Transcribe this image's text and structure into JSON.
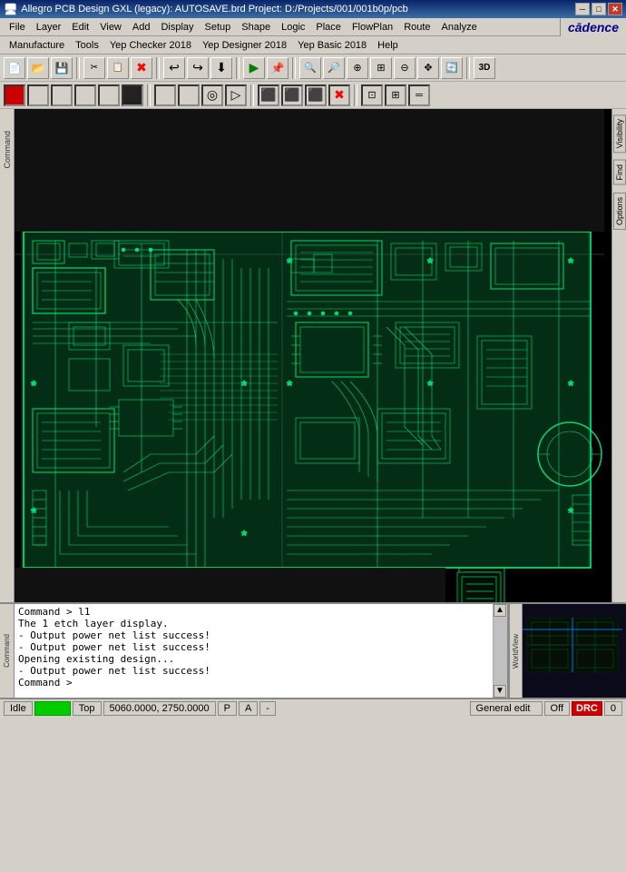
{
  "titlebar": {
    "title": "Allegro PCB Design GXL (legacy): AUTOSAVE.brd  Project: D:/Projects/001/001b0p/pcb",
    "minimize": "─",
    "maximize": "□",
    "close": "✕"
  },
  "menubar1": {
    "items": [
      "File",
      "Layer",
      "Edit",
      "View",
      "Add",
      "Display",
      "Setup",
      "Shape",
      "Logic",
      "Place",
      "FlowPlan",
      "Route",
      "Analyze"
    ]
  },
  "menubar2": {
    "items": [
      "Manufacture",
      "Tools",
      "Yep Checker 2018",
      "Yep Designer 2018",
      "Yep Basic 2018",
      "Help"
    ]
  },
  "cadence": {
    "logo": "cādence"
  },
  "toolbar1": {
    "buttons": [
      "📁",
      "📂",
      "💾",
      "✂",
      "📋",
      "🔴",
      "↩",
      "↪",
      "⬇",
      "🟢",
      "📌",
      "🔃",
      "⬜",
      "⬜",
      "📐",
      "🔍",
      "🔎",
      "🔍",
      "🔎",
      "⭕",
      "🔄",
      "3D"
    ]
  },
  "toolbar2": {
    "buttons": [
      "⬜",
      "⬜",
      "⬜",
      "⬜",
      "⬜",
      "⬜",
      "⬜",
      "⬜",
      "⬜",
      "⬜",
      "⬜",
      "⬜",
      "⬜",
      "🔴",
      "⬜",
      "⬜",
      "⬜"
    ]
  },
  "right_tabs": {
    "visibility": "Visibility",
    "find": "Find",
    "options": "Options"
  },
  "console": {
    "lines": [
      "Command > l1",
      "The 1 etch layer display.",
      "  - Output power net list success!",
      "  - Output power net list success!",
      "Opening existing design...",
      "  - Output power net list success!",
      "Command >"
    ]
  },
  "worldview": {
    "label": "WorldView"
  },
  "statusbar": {
    "idle": "Idle",
    "layer": "Top",
    "coords": "5060.0000, 2750.0000",
    "pad_indicator": "P",
    "arrow_indicator": "A",
    "dash": "-",
    "general_edit": "General edit",
    "off": "Off",
    "drc": "DRC",
    "number": "0"
  }
}
